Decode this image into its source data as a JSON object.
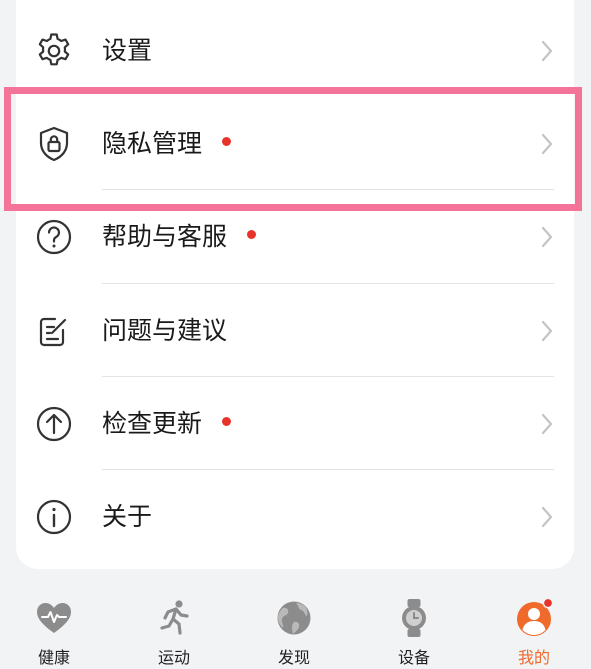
{
  "menu": {
    "items": [
      {
        "label": "设置",
        "icon": "gear-icon",
        "dot": false
      },
      {
        "label": "隐私管理",
        "icon": "shield-lock-icon",
        "dot": true
      },
      {
        "label": "帮助与客服",
        "icon": "question-circle-icon",
        "dot": true
      },
      {
        "label": "问题与建议",
        "icon": "feedback-edit-icon",
        "dot": false
      },
      {
        "label": "检查更新",
        "icon": "arrow-up-circle-icon",
        "dot": true
      },
      {
        "label": "关于",
        "icon": "info-circle-icon",
        "dot": false
      }
    ]
  },
  "tabbar": {
    "tabs": [
      {
        "label": "健康",
        "icon": "heart-pulse-icon",
        "active": false
      },
      {
        "label": "运动",
        "icon": "running-person-icon",
        "active": false
      },
      {
        "label": "发现",
        "icon": "globe-icon",
        "active": false
      },
      {
        "label": "设备",
        "icon": "watch-icon",
        "active": false
      },
      {
        "label": "我的",
        "icon": "user-avatar-icon",
        "active": true
      }
    ]
  },
  "colors": {
    "page_background": "#f1f3f5",
    "card_background": "#ffffff",
    "notification_dot": "#e8332a",
    "highlight_border": "#f47399",
    "active_tab": "#ef6a2b",
    "inactive_tab_icon": "#8c8c8c"
  }
}
